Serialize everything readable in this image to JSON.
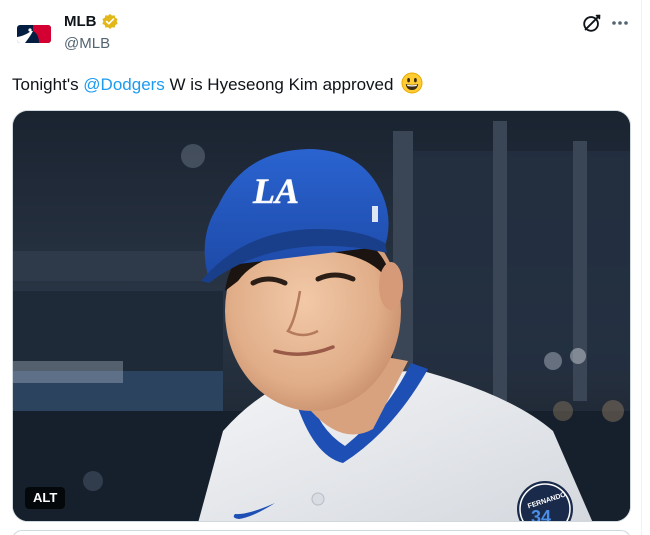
{
  "author": {
    "display_name": "MLB",
    "handle": "@MLB",
    "verified": true,
    "avatar_icon": "mlb-logo-icon",
    "verified_icon": "gold-verified-badge-icon"
  },
  "actions": {
    "grok_icon": "grok-icon",
    "more_icon": "more-horizontal-icon"
  },
  "tweet": {
    "text_before": "Tonight's ",
    "mention": "@Dodgers",
    "text_after": " W is Hyeseong Kim approved ",
    "emoji": "grinning-face-emoji"
  },
  "media": {
    "alt_label": "ALT",
    "cap_logo": "LA",
    "patch_name": "FERNANDO",
    "patch_number": "34"
  },
  "colors": {
    "mention": "#1d9bf0",
    "verified_gold": "#e2b719",
    "dodger_blue": "#1e4fb5",
    "mlb_red": "#d50032",
    "mlb_blue": "#041e42"
  }
}
